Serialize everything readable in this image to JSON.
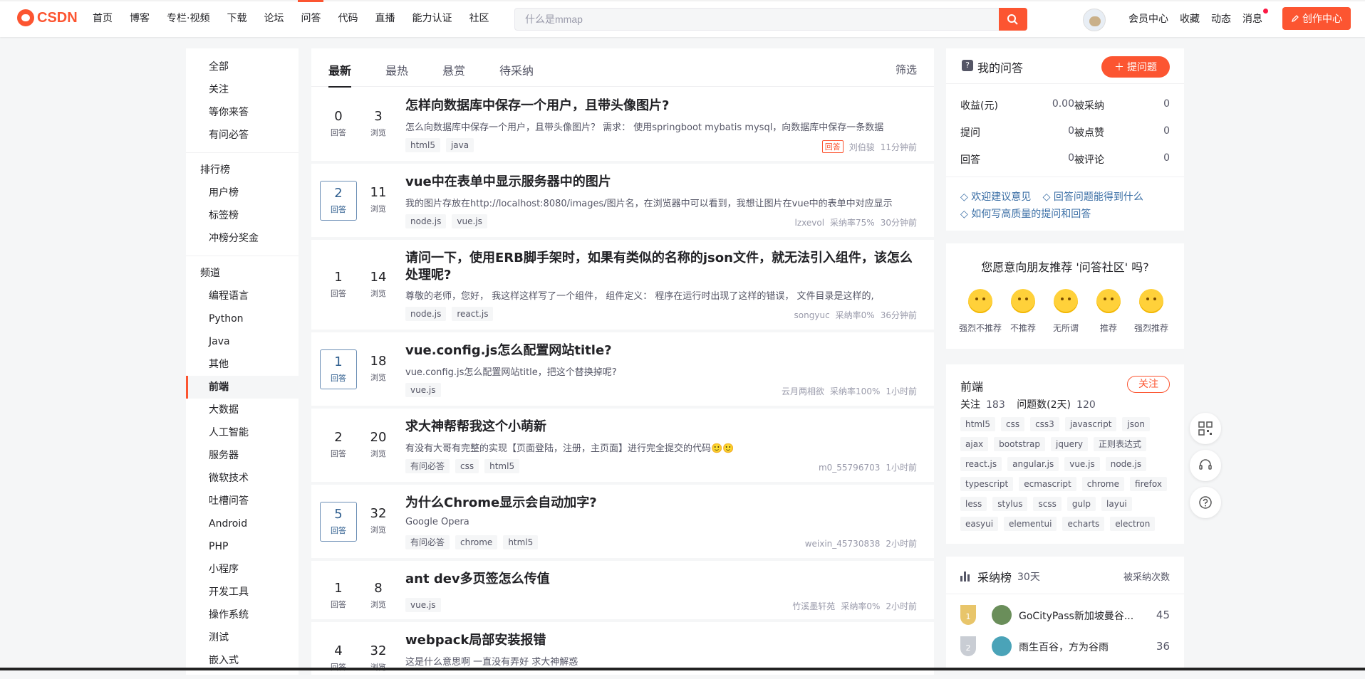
{
  "brand": {
    "logo_text": "CSDN"
  },
  "nav": [
    "首页",
    "博客",
    "专栏·视频",
    "下载",
    "论坛",
    "问答",
    "代码",
    "直播",
    "能力认证",
    "社区"
  ],
  "search": {
    "placeholder": "什么是mmap"
  },
  "toplinks": [
    "会员中心",
    "收藏",
    "动态",
    "消息"
  ],
  "create_btn": "创作中心",
  "sidebar": {
    "group1": [
      "全部",
      "关注",
      "等你来答",
      "有问必答"
    ],
    "rank_head": "排行榜",
    "rank_items": [
      "用户榜",
      "标签榜",
      "冲榜分奖金"
    ],
    "channel_head": "频道",
    "channels": [
      "编程语言",
      "Python",
      "Java",
      "其他",
      "前端",
      "大数据",
      "人工智能",
      "服务器",
      "微软技术",
      "吐槽问答",
      "Android",
      "PHP",
      "小程序",
      "开发工具",
      "操作系统",
      "测试",
      "嵌入式"
    ]
  },
  "tabs": {
    "items": [
      "最新",
      "最热",
      "悬赏",
      "待采纳"
    ],
    "filter": "筛选"
  },
  "labels": {
    "answers": "回答",
    "views": "浏览"
  },
  "questions": [
    {
      "answers": "0",
      "views": "3",
      "title": "怎样向数据库中保存一个用户，且带头像图片?",
      "desc": "怎么向数据库中保存一个用户，且带头像图片？ 需求： 使用springboot mybatis mysql，向数据库中保存一条数据",
      "tags": [
        "html5",
        "java"
      ],
      "badge": "回答",
      "author": "刘伯骏",
      "rate": "",
      "time": "11分钟前"
    },
    {
      "answers": "2",
      "views": "11",
      "title": "vue中在表单中显示服务器中的图片",
      "desc": "我的图片存放在http://localhost:8080/images/图片名，在浏览器中可以看到，我想让图片在vue中的表单中对应显示",
      "tags": [
        "node.js",
        "vue.js"
      ],
      "badge": "",
      "author": "lzxevol",
      "rate": "采纳率75%",
      "time": "30分钟前"
    },
    {
      "answers": "1",
      "views": "14",
      "title": "请问一下，使用ERB脚手架时，如果有类似的名称的json文件，就无法引入组件，该怎么处理呢?",
      "desc": "尊敬的老师，您好， 我这样这样写了一个组件， 组件定义： 程序在运行时出现了这样的错误， 文件目录是这样的,",
      "tags": [
        "node.js",
        "react.js"
      ],
      "badge": "",
      "author": "songyuc",
      "rate": "采纳率0%",
      "time": "36分钟前"
    },
    {
      "answers": "1",
      "views": "18",
      "title": "vue.config.js怎么配置网站title?",
      "desc": "vue.config.js怎么配置网站title，把这个替换掉呢?",
      "tags": [
        "vue.js"
      ],
      "badge": "",
      "author": "云月两相欲",
      "rate": "采纳率100%",
      "time": "1小时前"
    },
    {
      "answers": "2",
      "views": "20",
      "title": "求大神帮帮我这个小萌新",
      "desc": "有没有大哥有完整的实现【页面登陆，注册，主页面】进行完全提交的代码🙂🙂",
      "tags": [
        "有问必答",
        "css",
        "html5"
      ],
      "badge": "",
      "author": "m0_55796703",
      "rate": "",
      "time": "1小时前"
    },
    {
      "answers": "5",
      "views": "32",
      "title": "为什么Chrome显示会自动加字?",
      "desc": "Google Opera",
      "tags": [
        "有问必答",
        "chrome",
        "html5"
      ],
      "badge": "",
      "author": "weixin_45730838",
      "rate": "",
      "time": "2小时前"
    },
    {
      "answers": "1",
      "views": "8",
      "title": "ant dev多页签怎么传值",
      "desc": "",
      "tags": [
        "vue.js"
      ],
      "badge": "",
      "author": "竹溪墨轩苑",
      "rate": "采纳率0%",
      "time": "2小时前"
    },
    {
      "answers": "4",
      "views": "32",
      "title": "webpack局部安装报错",
      "desc": "这是什么意思啊 一直没有弄好 求大神解惑",
      "tags": [],
      "badge": "",
      "author": "",
      "rate": "",
      "time": ""
    }
  ],
  "myq": {
    "title": "我的问答",
    "ask_btn": "提问题",
    "stats": [
      {
        "label": "收益(元)",
        "value": "0.00"
      },
      {
        "label": "被采纳",
        "value": "0"
      },
      {
        "label": "提问",
        "value": "0"
      },
      {
        "label": "被点赞",
        "value": "0"
      },
      {
        "label": "回答",
        "value": "0"
      },
      {
        "label": "被评论",
        "value": "0"
      }
    ],
    "links": [
      "◇ 欢迎建议意见",
      "◇ 回答问题能得到什么",
      "◇ 如何写高质量的提问和回答"
    ]
  },
  "survey": {
    "title": "您愿意向朋友推荐 '问答社区' 吗?",
    "options": [
      "强烈不推荐",
      "不推荐",
      "无所谓",
      "推荐",
      "强烈推荐"
    ]
  },
  "topic": {
    "name": "前端",
    "follow": "关注",
    "follow_label": "关注",
    "follow_count": "183",
    "qcount_label": "问题数(2天)",
    "qcount": "120",
    "tags": [
      "html5",
      "css",
      "css3",
      "javascript",
      "json",
      "ajax",
      "bootstrap",
      "jquery",
      "正则表达式",
      "react.js",
      "angular.js",
      "vue.js",
      "node.js",
      "typescript",
      "ecmascript",
      "chrome",
      "firefox",
      "less",
      "stylus",
      "scss",
      "gulp",
      "layui",
      "easyui",
      "elementui",
      "echarts",
      "electron"
    ]
  },
  "rank": {
    "title": "采纳榜",
    "period": "30天",
    "right": "被采纳次数",
    "rows": [
      {
        "medal": "1",
        "name": "GoCityPass新加坡曼谷...",
        "score": "45"
      },
      {
        "medal": "2",
        "name": "雨生百谷，方为谷雨",
        "score": "36"
      }
    ]
  }
}
